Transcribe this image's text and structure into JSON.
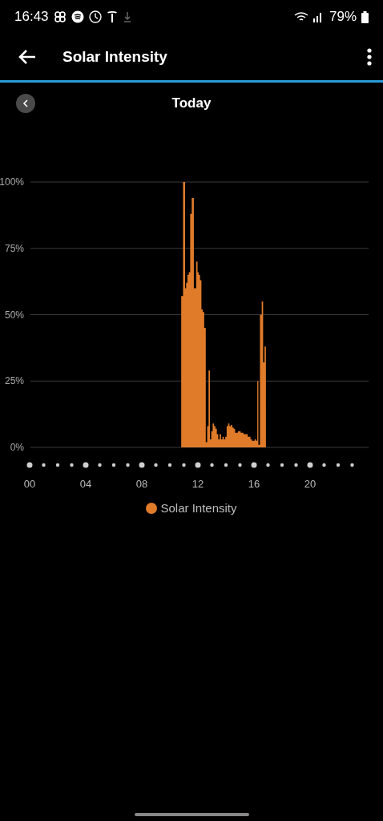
{
  "status_bar": {
    "time": "16:43",
    "battery": "79%"
  },
  "app_bar": {
    "title": "Solar Intensity"
  },
  "date_nav": {
    "label": "Today"
  },
  "chart_data": {
    "type": "area",
    "xlim": [
      0,
      24
    ],
    "ylim": [
      0,
      100
    ],
    "xticks": [
      {
        "value": 0,
        "label": "00"
      },
      {
        "value": 4,
        "label": "04"
      },
      {
        "value": 8,
        "label": "08"
      },
      {
        "value": 12,
        "label": "12"
      },
      {
        "value": 16,
        "label": "16"
      },
      {
        "value": 20,
        "label": "20"
      }
    ],
    "yticks": [
      {
        "value": 0,
        "label": "0%"
      },
      {
        "value": 25,
        "label": "25%"
      },
      {
        "value": 50,
        "label": "50%"
      },
      {
        "value": 75,
        "label": "75%"
      },
      {
        "value": 100,
        "label": "100%"
      }
    ],
    "grid": true,
    "x": [
      10.79,
      10.83,
      11.05,
      11.12,
      11.2,
      11.3,
      11.4,
      11.5,
      11.62,
      11.8,
      11.95,
      12.0,
      12.1,
      12.2,
      12.3,
      12.4,
      12.5,
      12.62,
      12.7,
      12.82,
      12.9,
      13.0,
      13.1,
      13.2,
      13.3,
      13.4,
      13.5,
      13.6,
      13.7,
      13.8,
      13.9,
      14.0,
      14.1,
      14.2,
      14.3,
      14.4,
      14.5,
      14.6,
      14.7,
      14.8,
      14.9,
      15.0,
      15.1,
      15.2,
      15.3,
      15.4,
      15.5,
      15.6,
      15.7,
      15.8,
      15.9,
      16.0,
      16.1,
      16.2,
      16.27,
      16.35,
      16.5,
      16.6,
      16.7,
      16.8
    ],
    "series": [
      {
        "name": "Solar Intensity",
        "color": "#e07b2a",
        "values": [
          0,
          57,
          100,
          60,
          62,
          65,
          66,
          88,
          94,
          60,
          70,
          66,
          65,
          63,
          52,
          51,
          45,
          2,
          8,
          29,
          3,
          6,
          9,
          8,
          7,
          5,
          3,
          5,
          3,
          4,
          3,
          4,
          8,
          9,
          8,
          8.5,
          7.5,
          7,
          5.5,
          5.5,
          6,
          6,
          5.5,
          5.5,
          5,
          5,
          5,
          4,
          4,
          3,
          2.5,
          2.5,
          3,
          2.5,
          25,
          1,
          50,
          55,
          32,
          38
        ]
      }
    ]
  }
}
